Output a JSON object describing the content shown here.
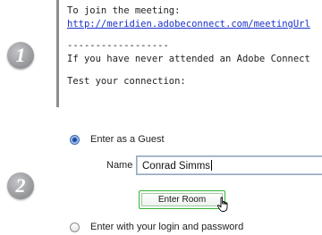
{
  "steps": {
    "one": "1",
    "two": "2"
  },
  "email": {
    "line1": "To join the meeting:",
    "link": "http://meridien.adobeconnect.com/meetingUrl",
    "separator": "------------------",
    "line2": "If you have never attended an Adobe Connect",
    "line3": "Test your connection:"
  },
  "login": {
    "guest_option": "Enter as a Guest",
    "guest_selected": true,
    "name_label": "Name",
    "name_value": "Conrad Simms",
    "enter_button": "Enter Room",
    "login_option": "Enter with your login and password",
    "login_selected": false
  },
  "colors": {
    "link": "#1a31c9",
    "button_focus": "#36b336",
    "radio_selected": "#1d4aa0"
  },
  "icons": {
    "cursor": "hand-pointer-icon"
  }
}
